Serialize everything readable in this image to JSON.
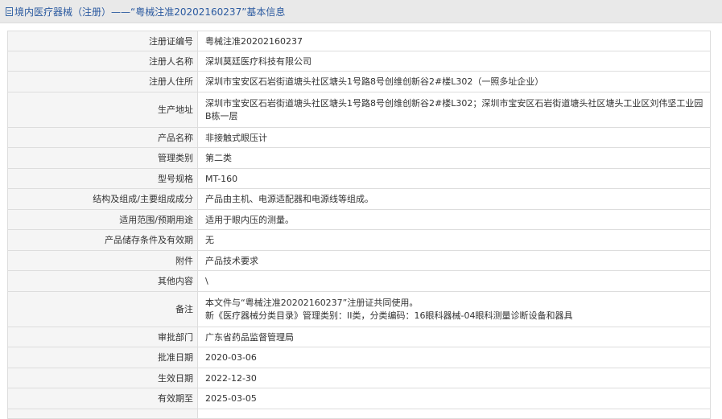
{
  "header": {
    "title": "境内医疗器械（注册）——“粤械注准20202160237”基本信息"
  },
  "rows": [
    {
      "label": "注册证编号",
      "value": "粤械注准20202160237"
    },
    {
      "label": "注册人名称",
      "value": "深圳莫廷医疗科技有限公司"
    },
    {
      "label": "注册人住所",
      "value": "深圳市宝安区石岩街道塘头社区塘头1号路8号创维创新谷2#楼L302（一照多址企业）"
    },
    {
      "label": "生产地址",
      "value": "深圳市宝安区石岩街道塘头社区塘头1号路8号创维创新谷2#楼L302；深圳市宝安区石岩街道塘头社区塘头工业区刘伟坚工业园B栋一层"
    },
    {
      "label": "产品名称",
      "value": "非接触式眼压计"
    },
    {
      "label": "管理类别",
      "value": "第二类"
    },
    {
      "label": "型号规格",
      "value": "MT-160"
    },
    {
      "label": "结构及组成/主要组成成分",
      "value": "产品由主机、电源适配器和电源线等组成。"
    },
    {
      "label": "适用范围/预期用途",
      "value": "适用于眼内压的测量。"
    },
    {
      "label": "产品储存条件及有效期",
      "value": "无"
    },
    {
      "label": "附件",
      "value": "产品技术要求"
    },
    {
      "label": "其他内容",
      "value": "\\"
    },
    {
      "label": "备注",
      "value_line1": "本文件与“粤械注准20202160237”注册证共同使用。",
      "value_line2": "新《医疗器械分类目录》管理类别：II类，分类编码：16眼科器械-04眼科测量诊断设备和器具"
    },
    {
      "label": "审批部门",
      "value": "广东省药品监督管理局"
    },
    {
      "label": "批准日期",
      "value": "2020-03-06"
    },
    {
      "label": "生效日期",
      "value": "2022-12-30"
    },
    {
      "label": "有效期至",
      "value": "2025-03-05"
    }
  ]
}
